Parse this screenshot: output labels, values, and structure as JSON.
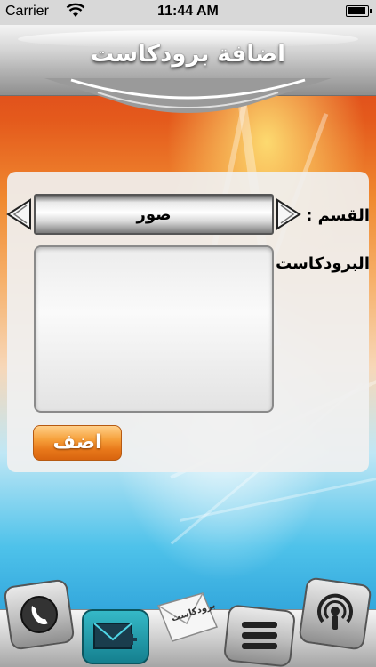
{
  "status_bar": {
    "carrier": "Carrier",
    "time": "11:44 AM"
  },
  "header": {
    "title": "اضافة برودكاست"
  },
  "form": {
    "section_label": "القسم :",
    "section_value": "صور",
    "broadcast_label": "البرودكاست :",
    "broadcast_value": "",
    "add_button_label": "اضف"
  },
  "tabbar": {
    "items": [
      {
        "icon": "phone-icon"
      },
      {
        "icon": "mail-icon"
      },
      {
        "icon": "broadcast-envelope-icon",
        "label": "برودكاست",
        "selected": true
      },
      {
        "icon": "menu-list-icon"
      },
      {
        "icon": "podcast-microphone-icon"
      }
    ]
  }
}
